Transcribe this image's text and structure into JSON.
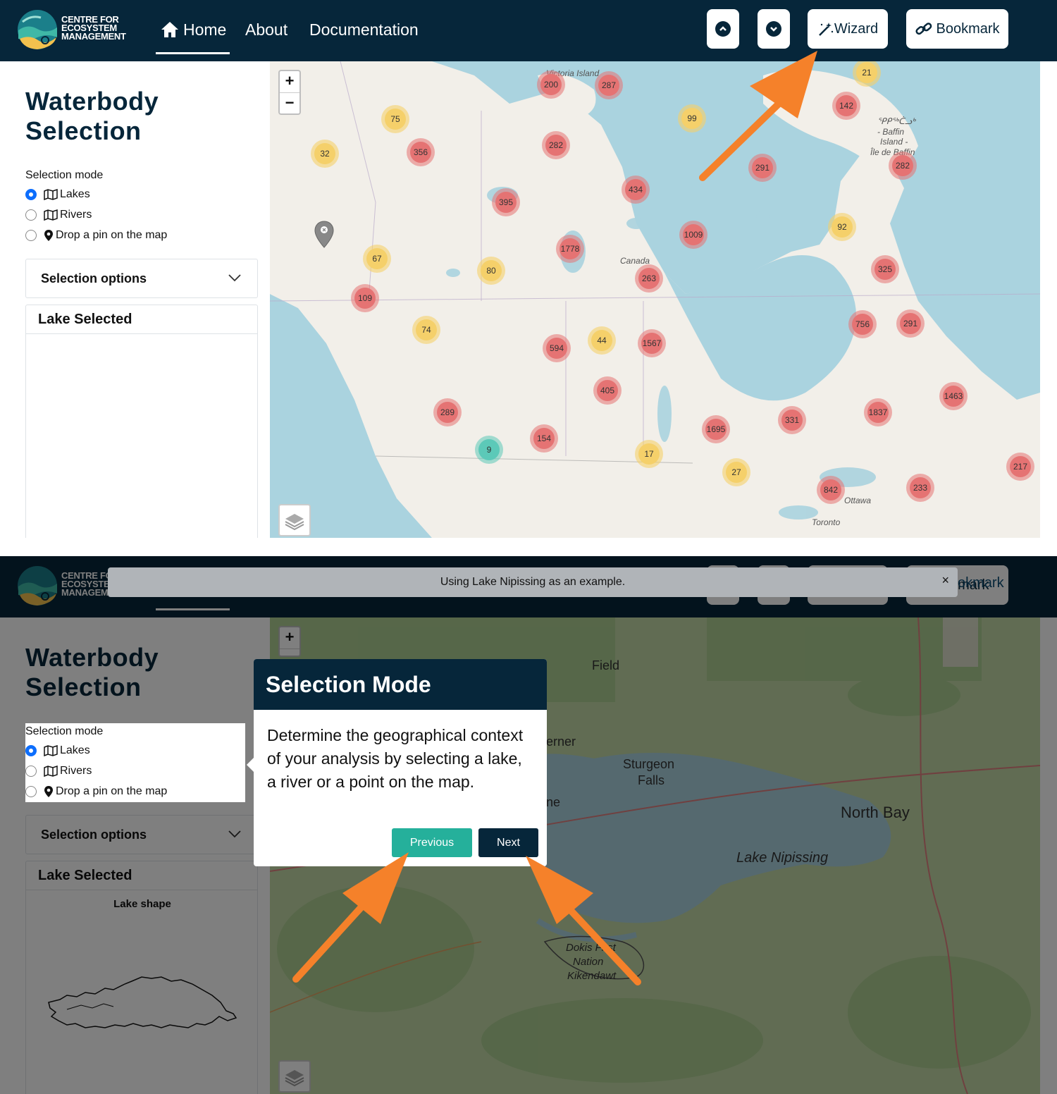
{
  "brand": {
    "line1": "CENTRE FOR",
    "line2": "ECOSYSTEM",
    "line3": "MANAGEMENT"
  },
  "nav": {
    "home": "Home",
    "about": "About",
    "documentation": "Documentation",
    "wizard": "Wizard",
    "bookmark": "Bookmark"
  },
  "sidebar": {
    "title_line1": "Waterbody",
    "title_line2": "Selection",
    "selection_mode_label": "Selection mode",
    "options": [
      "Lakes",
      "Rivers",
      "Drop a pin on the map"
    ],
    "selected_option": "Lakes",
    "selection_options_label": "Selection options",
    "lake_selected_label": "Lake Selected",
    "lake_shape_label": "Lake shape"
  },
  "map1": {
    "labels": [
      "Victoria Island",
      "ᕿᑭᖅᑖᓗᒃ",
      "- Baffin",
      "Island -",
      "Île de Baffin",
      "Canada",
      "Ottawa",
      "Toronto"
    ],
    "clusters": [
      {
        "value": "200",
        "level": "red"
      },
      {
        "value": "287",
        "level": "red"
      },
      {
        "value": "21",
        "level": "yellow"
      },
      {
        "value": "75",
        "level": "yellow"
      },
      {
        "value": "142",
        "level": "red"
      },
      {
        "value": "99",
        "level": "yellow"
      },
      {
        "value": "32",
        "level": "yellow"
      },
      {
        "value": "356",
        "level": "red"
      },
      {
        "value": "282",
        "level": "red"
      },
      {
        "value": "291",
        "level": "red"
      },
      {
        "value": "282",
        "level": "red"
      },
      {
        "value": "434",
        "level": "red"
      },
      {
        "value": "395",
        "level": "red"
      },
      {
        "value": "92",
        "level": "yellow"
      },
      {
        "value": "1009",
        "level": "red"
      },
      {
        "value": "1778",
        "level": "red"
      },
      {
        "value": "67",
        "level": "yellow"
      },
      {
        "value": "80",
        "level": "yellow"
      },
      {
        "value": "263",
        "level": "red"
      },
      {
        "value": "325",
        "level": "red"
      },
      {
        "value": "109",
        "level": "red"
      },
      {
        "value": "74",
        "level": "yellow"
      },
      {
        "value": "756",
        "level": "red"
      },
      {
        "value": "291",
        "level": "red"
      },
      {
        "value": "594",
        "level": "red"
      },
      {
        "value": "44",
        "level": "yellow"
      },
      {
        "value": "1567",
        "level": "red"
      },
      {
        "value": "405",
        "level": "red"
      },
      {
        "value": "1463",
        "level": "red"
      },
      {
        "value": "289",
        "level": "red"
      },
      {
        "value": "1837",
        "level": "red"
      },
      {
        "value": "331",
        "level": "red"
      },
      {
        "value": "1695",
        "level": "red"
      },
      {
        "value": "9",
        "level": "green"
      },
      {
        "value": "154",
        "level": "red"
      },
      {
        "value": "17",
        "level": "yellow"
      },
      {
        "value": "217",
        "level": "red"
      },
      {
        "value": "27",
        "level": "yellow"
      },
      {
        "value": "842",
        "level": "red"
      },
      {
        "value": "233",
        "level": "red"
      }
    ]
  },
  "map2": {
    "labels": [
      "Field",
      "erner",
      "Sturgeon",
      "Falls",
      "ne",
      "North Bay",
      "Lake Nipissing",
      "Dokis First",
      "Nation",
      "Kikendawt"
    ]
  },
  "wizard": {
    "toast": "Using Lake Nipissing as an example.",
    "close": "×",
    "popover_title": "Selection Mode",
    "popover_body": "Determine the geographical context of your analysis by selecting a lake, a river or a point on the map.",
    "previous": "Previous",
    "next": "Next",
    "bookmark_partial": "okmark"
  },
  "colors": {
    "navy": "#06263a",
    "teal": "#25b09b",
    "accent_arrow": "#f5812a",
    "cluster_red": "#e57373",
    "cluster_yellow": "#f5d06a",
    "cluster_green": "#5cc9b8"
  }
}
